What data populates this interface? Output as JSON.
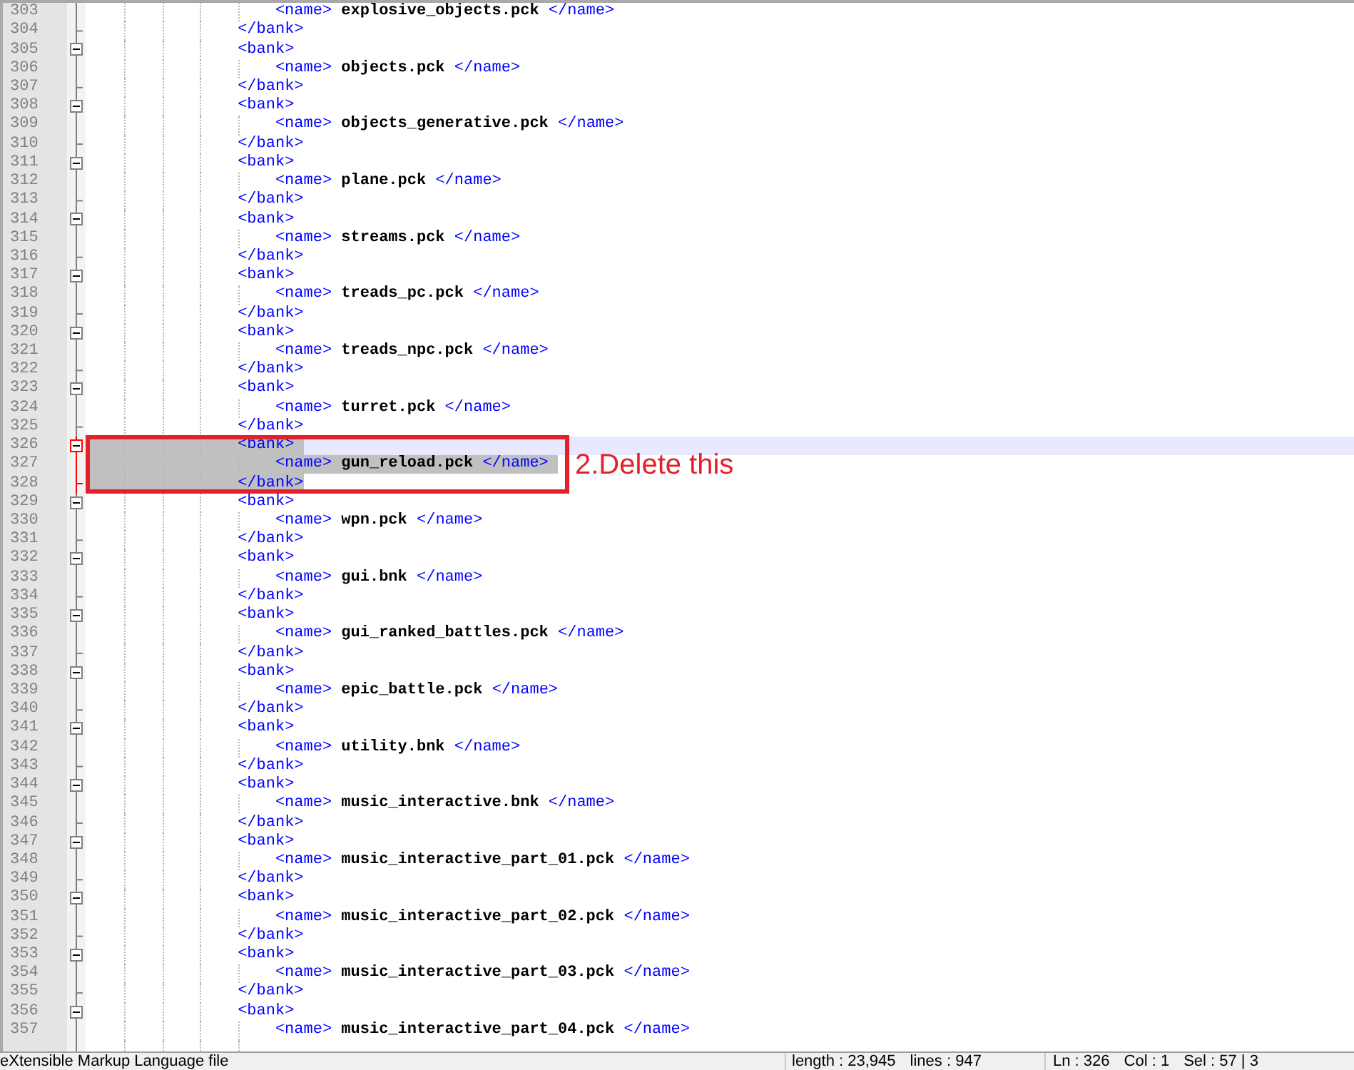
{
  "editor": {
    "lines": [
      {
        "number": "303",
        "kind": "name",
        "open_tag": "<name>",
        "value": "explosive_objects.pck",
        "close_tag": "</name>",
        "selected": false,
        "current": false
      },
      {
        "number": "304",
        "kind": "close",
        "tag": "</bank>",
        "selected": false,
        "current": false
      },
      {
        "number": "305",
        "kind": "open",
        "tag": "<bank>",
        "selected": false,
        "current": false
      },
      {
        "number": "306",
        "kind": "name",
        "open_tag": "<name>",
        "value": "objects.pck",
        "close_tag": "</name>",
        "selected": false,
        "current": false
      },
      {
        "number": "307",
        "kind": "close",
        "tag": "</bank>",
        "selected": false,
        "current": false
      },
      {
        "number": "308",
        "kind": "open",
        "tag": "<bank>",
        "selected": false,
        "current": false
      },
      {
        "number": "309",
        "kind": "name",
        "open_tag": "<name>",
        "value": "objects_generative.pck",
        "close_tag": "</name>",
        "selected": false,
        "current": false
      },
      {
        "number": "310",
        "kind": "close",
        "tag": "</bank>",
        "selected": false,
        "current": false
      },
      {
        "number": "311",
        "kind": "open",
        "tag": "<bank>",
        "selected": false,
        "current": false
      },
      {
        "number": "312",
        "kind": "name",
        "open_tag": "<name>",
        "value": "plane.pck",
        "close_tag": "</name>",
        "selected": false,
        "current": false
      },
      {
        "number": "313",
        "kind": "close",
        "tag": "</bank>",
        "selected": false,
        "current": false
      },
      {
        "number": "314",
        "kind": "open",
        "tag": "<bank>",
        "selected": false,
        "current": false
      },
      {
        "number": "315",
        "kind": "name",
        "open_tag": "<name>",
        "value": "streams.pck",
        "close_tag": "</name>",
        "selected": false,
        "current": false
      },
      {
        "number": "316",
        "kind": "close",
        "tag": "</bank>",
        "selected": false,
        "current": false
      },
      {
        "number": "317",
        "kind": "open",
        "tag": "<bank>",
        "selected": false,
        "current": false
      },
      {
        "number": "318",
        "kind": "name",
        "open_tag": "<name>",
        "value": "treads_pc.pck",
        "close_tag": "</name>",
        "selected": false,
        "current": false
      },
      {
        "number": "319",
        "kind": "close",
        "tag": "</bank>",
        "selected": false,
        "current": false
      },
      {
        "number": "320",
        "kind": "open",
        "tag": "<bank>",
        "selected": false,
        "current": false
      },
      {
        "number": "321",
        "kind": "name",
        "open_tag": "<name>",
        "value": "treads_npc.pck",
        "close_tag": "</name>",
        "selected": false,
        "current": false
      },
      {
        "number": "322",
        "kind": "close",
        "tag": "</bank>",
        "selected": false,
        "current": false
      },
      {
        "number": "323",
        "kind": "open",
        "tag": "<bank>",
        "selected": false,
        "current": false
      },
      {
        "number": "324",
        "kind": "name",
        "open_tag": "<name>",
        "value": "turret.pck",
        "close_tag": "</name>",
        "selected": false,
        "current": false
      },
      {
        "number": "325",
        "kind": "close",
        "tag": "</bank>",
        "selected": false,
        "current": false
      },
      {
        "number": "326",
        "kind": "open",
        "tag": "<bank>",
        "selected": true,
        "current": true
      },
      {
        "number": "327",
        "kind": "name",
        "open_tag": "<name>",
        "value": "gun_reload.pck",
        "close_tag": "</name>",
        "selected": true,
        "current": false
      },
      {
        "number": "328",
        "kind": "close",
        "tag": "</bank>",
        "selected": true,
        "current": false
      },
      {
        "number": "329",
        "kind": "open",
        "tag": "<bank>",
        "selected": false,
        "current": false
      },
      {
        "number": "330",
        "kind": "name",
        "open_tag": "<name>",
        "value": "wpn.pck",
        "close_tag": "</name>",
        "selected": false,
        "current": false
      },
      {
        "number": "331",
        "kind": "close",
        "tag": "</bank>",
        "selected": false,
        "current": false
      },
      {
        "number": "332",
        "kind": "open",
        "tag": "<bank>",
        "selected": false,
        "current": false
      },
      {
        "number": "333",
        "kind": "name",
        "open_tag": "<name>",
        "value": "gui.bnk",
        "close_tag": "</name>",
        "selected": false,
        "current": false
      },
      {
        "number": "334",
        "kind": "close",
        "tag": "</bank>",
        "selected": false,
        "current": false
      },
      {
        "number": "335",
        "kind": "open",
        "tag": "<bank>",
        "selected": false,
        "current": false
      },
      {
        "number": "336",
        "kind": "name",
        "open_tag": "<name>",
        "value": "gui_ranked_battles.pck",
        "close_tag": "</name>",
        "selected": false,
        "current": false
      },
      {
        "number": "337",
        "kind": "close",
        "tag": "</bank>",
        "selected": false,
        "current": false
      },
      {
        "number": "338",
        "kind": "open",
        "tag": "<bank>",
        "selected": false,
        "current": false
      },
      {
        "number": "339",
        "kind": "name",
        "open_tag": "<name>",
        "value": "epic_battle.pck",
        "close_tag": "</name>",
        "selected": false,
        "current": false
      },
      {
        "number": "340",
        "kind": "close",
        "tag": "</bank>",
        "selected": false,
        "current": false
      },
      {
        "number": "341",
        "kind": "open",
        "tag": "<bank>",
        "selected": false,
        "current": false
      },
      {
        "number": "342",
        "kind": "name",
        "open_tag": "<name>",
        "value": "utility.bnk",
        "close_tag": "</name>",
        "selected": false,
        "current": false
      },
      {
        "number": "343",
        "kind": "close",
        "tag": "</bank>",
        "selected": false,
        "current": false
      },
      {
        "number": "344",
        "kind": "open",
        "tag": "<bank>",
        "selected": false,
        "current": false
      },
      {
        "number": "345",
        "kind": "name",
        "open_tag": "<name>",
        "value": "music_interactive.bnk",
        "close_tag": "</name>",
        "selected": false,
        "current": false
      },
      {
        "number": "346",
        "kind": "close",
        "tag": "</bank>",
        "selected": false,
        "current": false
      },
      {
        "number": "347",
        "kind": "open",
        "tag": "<bank>",
        "selected": false,
        "current": false
      },
      {
        "number": "348",
        "kind": "name",
        "open_tag": "<name>",
        "value": "music_interactive_part_01.pck",
        "close_tag": "</name>",
        "selected": false,
        "current": false
      },
      {
        "number": "349",
        "kind": "close",
        "tag": "</bank>",
        "selected": false,
        "current": false
      },
      {
        "number": "350",
        "kind": "open",
        "tag": "<bank>",
        "selected": false,
        "current": false
      },
      {
        "number": "351",
        "kind": "name",
        "open_tag": "<name>",
        "value": "music_interactive_part_02.pck",
        "close_tag": "</name>",
        "selected": false,
        "current": false
      },
      {
        "number": "352",
        "kind": "close",
        "tag": "</bank>",
        "selected": false,
        "current": false
      },
      {
        "number": "353",
        "kind": "open",
        "tag": "<bank>",
        "selected": false,
        "current": false
      },
      {
        "number": "354",
        "kind": "name",
        "open_tag": "<name>",
        "value": "music_interactive_part_03.pck",
        "close_tag": "</name>",
        "selected": false,
        "current": false
      },
      {
        "number": "355",
        "kind": "close",
        "tag": "</bank>",
        "selected": false,
        "current": false
      },
      {
        "number": "356",
        "kind": "open",
        "tag": "<bank>",
        "selected": false,
        "current": false
      },
      {
        "number": "357",
        "kind": "name",
        "open_tag": "<name>",
        "value": "music_interactive_part_04.pck",
        "close_tag": "</name>",
        "selected": false,
        "current": false
      }
    ]
  },
  "annotation": {
    "text": "2.Delete this"
  },
  "status_bar": {
    "file_type": "eXtensible Markup Language file",
    "length": "length : 23,945",
    "lines": "lines : 947",
    "ln": "Ln : 326",
    "col": "Col : 1",
    "sel": "Sel : 57 | 3"
  }
}
